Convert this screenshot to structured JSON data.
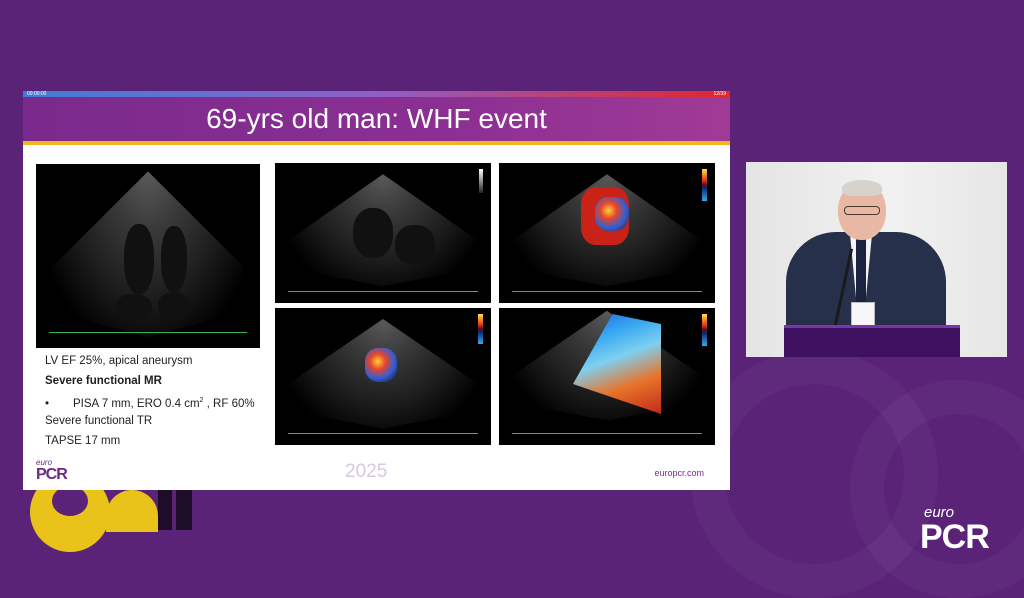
{
  "slide": {
    "progress_time": "00:00:00",
    "progress_page": "12/39",
    "title": "69-yrs old man: WHF event",
    "caption": {
      "line1": "LV EF 25%, apical aneurysm",
      "line2": "Severe functional MR",
      "line3_bullet": "•",
      "line3_pre": "PISA 7 mm, ERO 0.4 cm",
      "line3_sup": "2",
      "line3_post": " , RF 60%",
      "line4": "Severe functional TR",
      "line5": "TAPSE 17 mm"
    },
    "footer_year": "2025",
    "footer_url": "europcr.com",
    "logo_small": "euro",
    "logo_big": "PCR"
  },
  "brand_logo": {
    "small": "euro",
    "big": "PCR"
  },
  "colors": {
    "background": "#5b2378",
    "title_bar": "#8c2f93",
    "accent_yellow": "#f2b51d"
  }
}
